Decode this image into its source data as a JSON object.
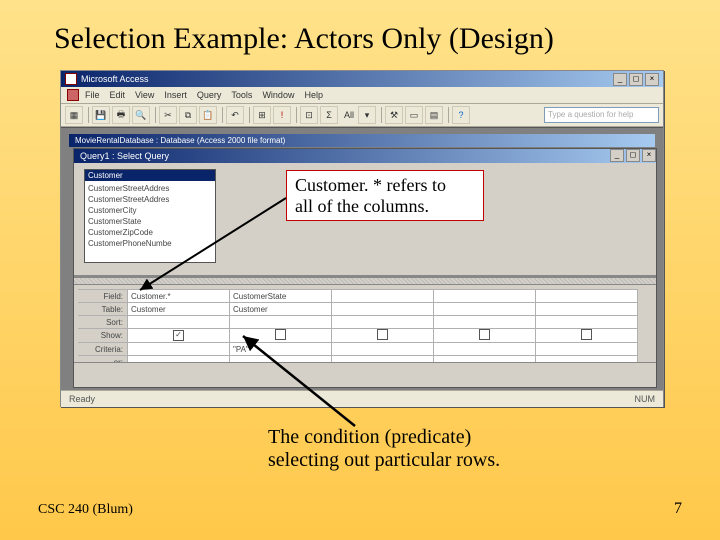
{
  "slide": {
    "title": "Selection Example: Actors Only (Design)",
    "footer_left": "CSC 240 (Blum)",
    "page_number": "7"
  },
  "callouts": {
    "c1_line1": "Customer. * refers to",
    "c1_line2": "all of the columns.",
    "c2_line1": "The condition (predicate)",
    "c2_line2": "selecting out particular rows."
  },
  "access": {
    "app_title": "Microsoft Access",
    "help_placeholder": "Type a question for help",
    "menu": [
      "File",
      "Edit",
      "View",
      "Insert",
      "Query",
      "Tools",
      "Window",
      "Help"
    ],
    "toolbar_all": "All",
    "db_window_title": "MovieRentalDatabase : Database (Access 2000 file format)",
    "query_window_title": "Query1 : Select Query",
    "table": {
      "name": "Customer",
      "fields": [
        "CustomerStreetAddres",
        "CustomerStreetAddres",
        "CustomerCity",
        "CustomerState",
        "CustomerZipCode",
        "CustomerPhoneNumbe"
      ]
    },
    "grid": {
      "row_headers": [
        "Field:",
        "Table:",
        "Sort:",
        "Show:",
        "Criteria:",
        "or:"
      ],
      "cols": [
        {
          "field": "Customer.*",
          "table": "Customer",
          "show": true,
          "criteria": ""
        },
        {
          "field": "CustomerState",
          "table": "Customer",
          "show": false,
          "criteria": "\"PA\""
        },
        {
          "field": "",
          "table": "",
          "show": false,
          "criteria": ""
        },
        {
          "field": "",
          "table": "",
          "show": false,
          "criteria": ""
        },
        {
          "field": "",
          "table": "",
          "show": false,
          "criteria": ""
        }
      ]
    },
    "status_left": "Ready",
    "status_right": "NUM"
  }
}
